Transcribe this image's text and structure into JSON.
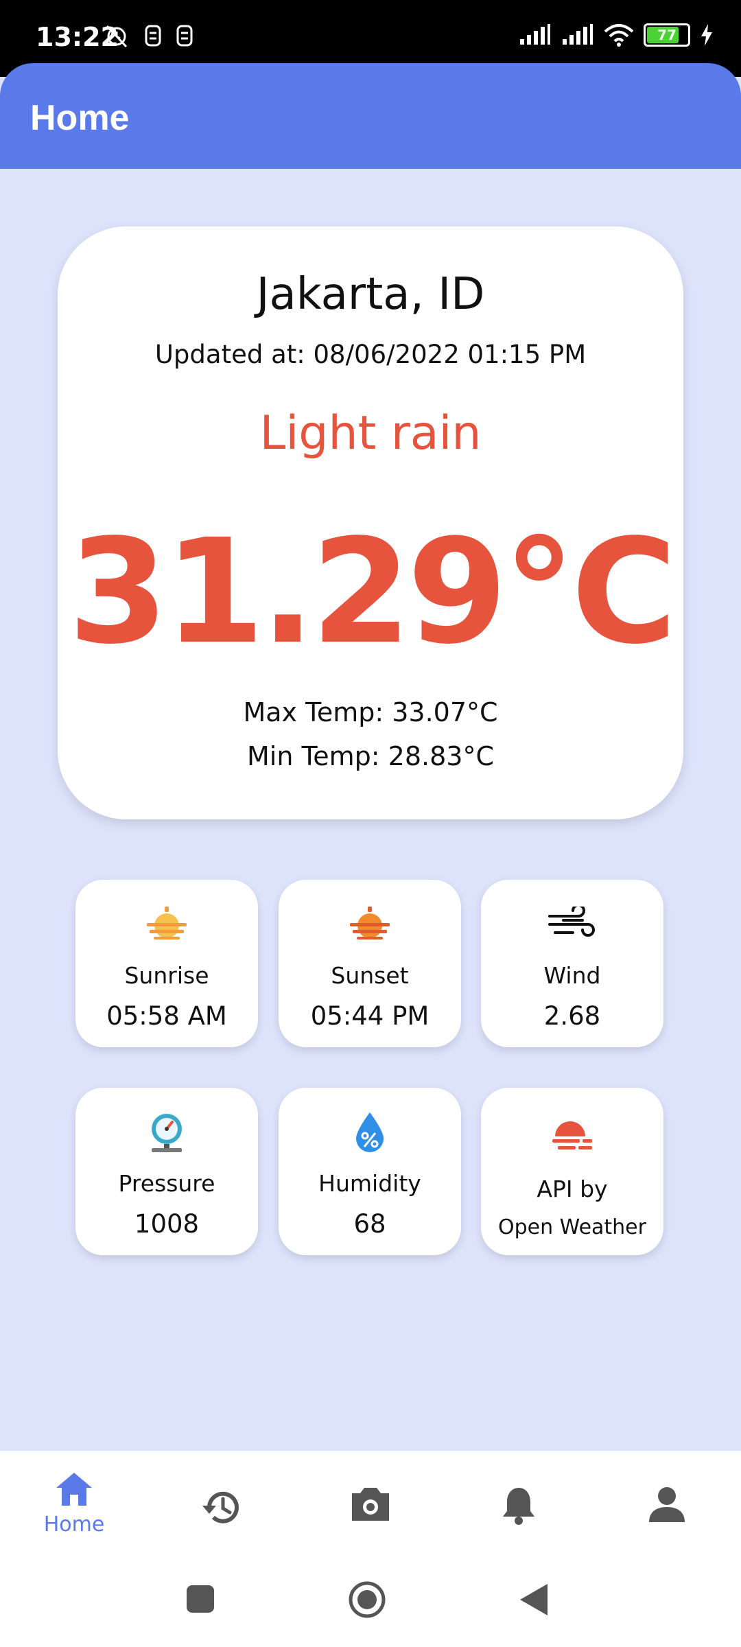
{
  "status_bar": {
    "time": "13:22",
    "battery": "77"
  },
  "app_bar": {
    "title": "Home"
  },
  "weather": {
    "city": "Jakarta, ID",
    "updated": "Updated at: 08/06/2022 01:15 PM",
    "condition": "Light rain",
    "temperature": "31.29°C",
    "max_temp": "Max Temp: 33.07°C",
    "min_temp": "Min Temp: 28.83°C"
  },
  "tiles": [
    {
      "label": "Sunrise",
      "value": "05:58 AM",
      "icon": "sunrise-icon"
    },
    {
      "label": "Sunset",
      "value": "05:44 PM",
      "icon": "sunset-icon"
    },
    {
      "label": "Wind",
      "value": "2.68",
      "icon": "wind-icon"
    },
    {
      "label": "Pressure",
      "value": "1008",
      "icon": "pressure-gauge-icon"
    },
    {
      "label": "Humidity",
      "value": "68",
      "icon": "humidity-drop-icon"
    },
    {
      "label": "API by",
      "value": "Open Weather",
      "icon": "open-weather-icon"
    }
  ],
  "bottom_nav": {
    "items": [
      {
        "label": "Home",
        "icon": "home-icon",
        "active": true
      },
      {
        "icon": "history-icon"
      },
      {
        "icon": "camera-icon"
      },
      {
        "icon": "notification-bell-icon"
      },
      {
        "icon": "profile-icon"
      }
    ]
  },
  "colors": {
    "primary": "#5a7aea",
    "accent": "#e6543e",
    "background": "#dde3fb"
  }
}
